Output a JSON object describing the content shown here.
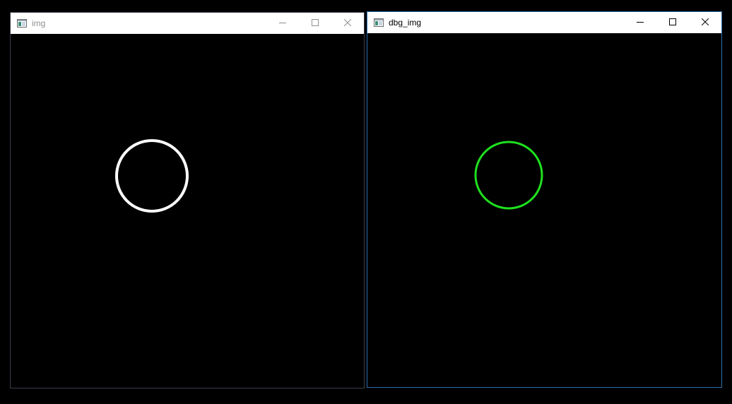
{
  "windows": [
    {
      "title": "img",
      "state": "inactive",
      "circle_color": "#ffffff"
    },
    {
      "title": "dbg_img",
      "state": "active",
      "circle_color": "#1ee01e"
    }
  ],
  "colors": {
    "desktop": "#000000",
    "titlebar": "#ffffff",
    "active_border": "#2f6fb0",
    "inactive_title_text": "#8f8f8f",
    "active_title_text": "#000000"
  },
  "icons": {
    "app": "opencv-window-icon",
    "minimize": "minimize-icon",
    "maximize": "maximize-icon",
    "close": "close-icon"
  }
}
